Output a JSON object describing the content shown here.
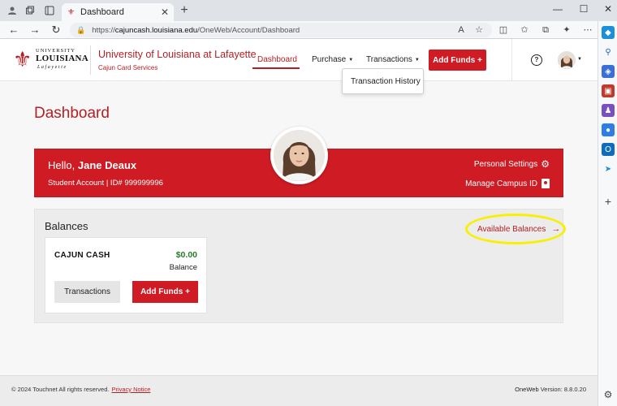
{
  "browser": {
    "tab_title": "Dashboard",
    "url_prefix": "https://",
    "url_host": "cajuncash.louisiana.edu",
    "url_path": "/OneWeb/Account/Dashboard"
  },
  "header": {
    "logo_univ": "UNIVERSITY",
    "logo_name": "LOUISIANA",
    "logo_sub": "Lafayette",
    "title": "University of Louisiana at Lafayette",
    "subtitle": "Cajun Card Services",
    "nav": {
      "dashboard": "Dashboard",
      "purchase": "Purchase",
      "transactions": "Transactions"
    },
    "add_funds": "Add Funds +",
    "help": "?"
  },
  "dropdown": {
    "item": "Transaction History"
  },
  "page": {
    "title": "Dashboard"
  },
  "hero": {
    "greeting": "Hello, ",
    "name": "Jane Deaux",
    "account": "Student Account | ID# 999999996",
    "personal_settings": "Personal Settings",
    "manage_id": "Manage Campus ID"
  },
  "balances": {
    "title": "Balances",
    "available_link": "Available Balances",
    "cards": [
      {
        "name": "CAJUN CASH",
        "amount": "$0.00",
        "label": "Balance",
        "transactions_btn": "Transactions",
        "add_funds_btn": "Add Funds +"
      }
    ]
  },
  "footer": {
    "copyright": "© 2024 Touchnet All rights reserved.",
    "privacy": "Privacy Notice",
    "version_brand": "OneWeb",
    "version_text": " Version: 8.8.0.20"
  },
  "colors": {
    "brand_red": "#cf1c24",
    "balance_green": "#2a7a2a",
    "highlight_yellow": "#f7f000"
  }
}
